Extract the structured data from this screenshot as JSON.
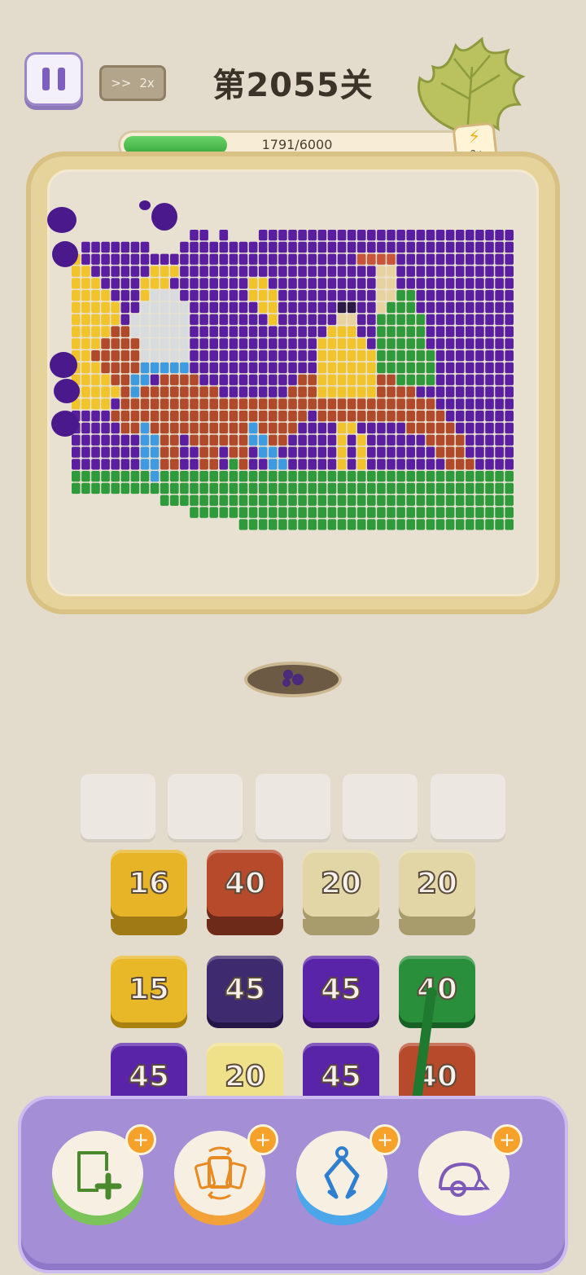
{
  "header": {
    "level_title": "第2055关",
    "speed_arrows": ">>",
    "speed_label": "2x",
    "progress_text": "1791/6000",
    "progress_fraction": 0.2985,
    "boost_label": "2x",
    "pause_icon": "pause-icon",
    "boost_icon": "lightning-icon",
    "leaf_icon": "leaf-icon"
  },
  "board": {
    "pattern": [
      "............PP.P...PPPPPPPPPPPPPPPPPPPPPPPPPP",
      ".PPPPPPP...PPPPPPPPPPPPPPPPPPPPPPPPPPPPPPPPPP",
      "YPPPPPPPPPPPPPPPPPPPPPPPPPPPPOOOOPPPPPPPPPPPP",
      "YYPPPPPPYYYPPPPPPPPPPPPPPPPPPPPTTPPPPPPPPPPPP",
      "YYYPPPPYYYPPPPPPPPYYPPPPPPPPPPPTTPPPPPPPPPPPP",
      "YYYYPPPYWWWPPPPPPPYYYPPPPPPPPPPTTGGPPPPPPPPPP",
      "YYYYYPPWWWWWPPPPPPPYYPPPPPPDDPPTGGGPPPPPPPPPP",
      "YYYYYPWWWWWWPPPPPPPPYPPPPPPTTPPGGGGGPPPPPPPPP",
      "YYYYRRWWWWWWPPPPPPPPPPPPPPYYYPPGGGGGPPPPPPPPP",
      "YYYRRRRWWWWWPPPPPPPPPPPPPYYYYYPGGGGGPPPPPPPPP",
      "YYRRRRRWWWWWPPPPPPPPPPPPPYYYYYYGGGGGGPPPPPPPP",
      "YYYRRRRBBBBBPPPPPPPPPPPPPYYYYYYGGGGGGPPPPPPPP",
      "YYYYRRBBPRRRRPPPPPPPPPPRRYYYYYYRRGGGGPPPPPPPP",
      "YYYYYRBRRRRRRRRPPPPPPPRRRYYYYYYRRRRPPPPPPPPPP",
      "YYYYPRRRRRRRRRRRRRRRRRRRRRRRRRRRRRRRRPPPPPPPP",
      "PPPPRRRRRRRRRRRRRRRRRRRRPRRRRRRRRRRRRRPPPPPPP",
      "PPPPPRRBRRRRRRRRRRBRRRRPPPPYYPPPPPRRRRRPPPPPP",
      "PPPPPPPBBRRPRRRRRRBBRRPPPPPYPYPPPPPPRRRRPPPPP",
      "PPPPPPPBBRRPPRRPRRPBBPPPPPPYPYPPPPPPPRRRPPPPP",
      "PPPPPPPBBRRPPRRPGRPPBBPPPPPYPYPPPPPPPPRRRPPPP",
      "GGGGGGGGBGGGGGGGGGGGGGGGGGGGGGGGGGGGGGGGGGGGG",
      "GGGGGGGGGGGGGGGGGGGGGGGGGGGGGGGGGGGGGGGGGGGGG",
      ".........GGGGGGGGGGGGGGGGGGGGGGGGGGGGGGGGGGGG",
      "............GGGGGGGGGGGGGGGGGGGGGGGGGGGGGGGGG",
      ".................GGGGGGGGGGGGGGGGGGGGGGGGGGGG"
    ],
    "colors": {
      "P": "#5a1fa0",
      "Y": "#f0c42a",
      "W": "#d8dcdf",
      "R": "#b04a2a",
      "B": "#3f9be0",
      "G": "#2f9a3c",
      "O": "#c8553a",
      "T": "#e8d3a0",
      "D": "#2a1845"
    },
    "hole_icon": "hole-icon"
  },
  "tiles": [
    {
      "label": "16",
      "color": "#e6b426",
      "shadow": "#a07a14"
    },
    {
      "label": "40",
      "color": "#b84a2c",
      "shadow": "#6e2a18"
    },
    {
      "label": "20",
      "color": "#e2d6a6",
      "shadow": "#a89b6c"
    },
    {
      "label": "20",
      "color": "#e2d6a6",
      "shadow": "#a89b6c"
    },
    {
      "label": "15",
      "color": "#e8b828",
      "shadow": "#a88110"
    },
    {
      "label": "45",
      "color": "#3e2a6e",
      "shadow": "#241748"
    },
    {
      "label": "45",
      "color": "#5a24a8",
      "shadow": "#3a1470"
    },
    {
      "label": "40",
      "color": "#2a8f3a",
      "shadow": "#176124"
    },
    {
      "label": "45",
      "color": "#5a24a8",
      "shadow": "#3a1470"
    },
    {
      "label": "20",
      "color": "#efe08a",
      "shadow": "#b3a25a"
    },
    {
      "label": "45",
      "color": "#5a24a8",
      "shadow": "#3a1470"
    },
    {
      "label": "40",
      "color": "#b84a2c",
      "shadow": "#6e2a18"
    }
  ],
  "tools": [
    {
      "name": "add-slot-icon",
      "plus": "+",
      "base": "#7cc35a"
    },
    {
      "name": "shuffle-icon",
      "plus": "+",
      "base": "#f3a23a"
    },
    {
      "name": "claw-icon",
      "plus": "+",
      "base": "#4ba6ea"
    },
    {
      "name": "vacuum-icon",
      "plus": "+",
      "base": "#a78be0"
    }
  ]
}
